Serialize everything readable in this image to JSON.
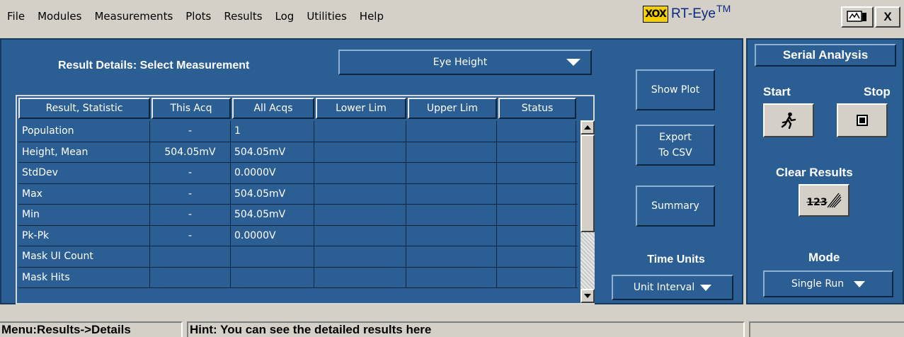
{
  "menu": {
    "items": [
      "File",
      "Modules",
      "Measurements",
      "Plots",
      "Results",
      "Log",
      "Utilities",
      "Help"
    ]
  },
  "logo": {
    "mark": "XOX",
    "product": "RT-Eye",
    "trademark": "TM"
  },
  "window_buttons": {
    "minimize_icon": "minimize-window-icon",
    "close_label": "X"
  },
  "details": {
    "title": "Result Details: Select Measurement",
    "selected_measurement": "Eye Height"
  },
  "table": {
    "columns": [
      "Result, Statistic",
      "This Acq",
      "All Acqs",
      "Lower Lim",
      "Upper Lim",
      "Status"
    ],
    "rows": [
      [
        "Population",
        "-",
        "1",
        "",
        "",
        ""
      ],
      [
        "Height, Mean",
        "504.05mV",
        "504.05mV",
        "",
        "",
        ""
      ],
      [
        "StdDev",
        "-",
        "0.0000V",
        "",
        "",
        ""
      ],
      [
        "Max",
        "-",
        "504.05mV",
        "",
        "",
        ""
      ],
      [
        "Min",
        "-",
        "504.05mV",
        "",
        "",
        ""
      ],
      [
        "Pk-Pk",
        "-",
        "0.0000V",
        "",
        "",
        ""
      ],
      [
        "Mask UI Count",
        "",
        "",
        "",
        "",
        ""
      ],
      [
        "Mask Hits",
        "",
        "",
        "",
        "",
        ""
      ]
    ]
  },
  "actions": {
    "show_plot": "Show Plot",
    "export_csv": "Export\nTo CSV",
    "summary": "Summary"
  },
  "time_units": {
    "label": "Time Units",
    "value": "Unit Interval"
  },
  "panel": {
    "title": "Serial Analysis",
    "start_label": "Start",
    "stop_label": "Stop",
    "clear_label": "Clear Results",
    "clear_icon_text": "123",
    "mode_label": "Mode",
    "mode_value": "Single Run"
  },
  "status": {
    "menu_path": "Menu:Results->Details",
    "hint": "Hint: You can see the detailed results here"
  },
  "colors": {
    "panel_blue": "#2b5f94",
    "chrome_gray": "#d4d0c8",
    "logo_yellow": "#f5d000"
  }
}
